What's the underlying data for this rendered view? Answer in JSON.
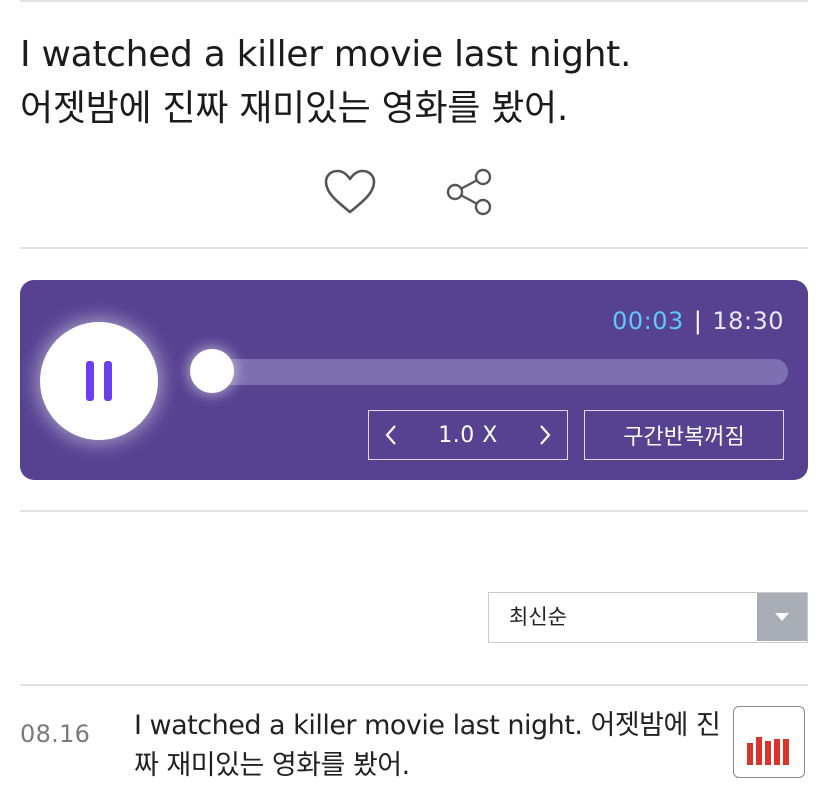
{
  "sentence": {
    "english": "I watched a killer movie last night.",
    "korean": "어젯밤에 진짜 재미있는 영화를 봤어."
  },
  "actions": {
    "like_icon": "heart-outline-icon",
    "share_icon": "share-icon"
  },
  "player": {
    "state": "playing",
    "current_time": "00:03",
    "separator": "|",
    "total_time": "18:30",
    "progress": 0.003,
    "speed": "1.0 X",
    "repeat_label": "구간반복꺼짐",
    "colors": {
      "background": "#574292",
      "accent": "#6a3ff0",
      "time_current": "#5fc8ff"
    }
  },
  "sort": {
    "selected": "최신순"
  },
  "list": [
    {
      "date": "08.16",
      "text": "I watched a killer movie last night. 어젯밤에 진짜 재미있는 영화를 봤어.",
      "icon": "equalizer-icon",
      "icon_color": "#d9342b"
    }
  ]
}
